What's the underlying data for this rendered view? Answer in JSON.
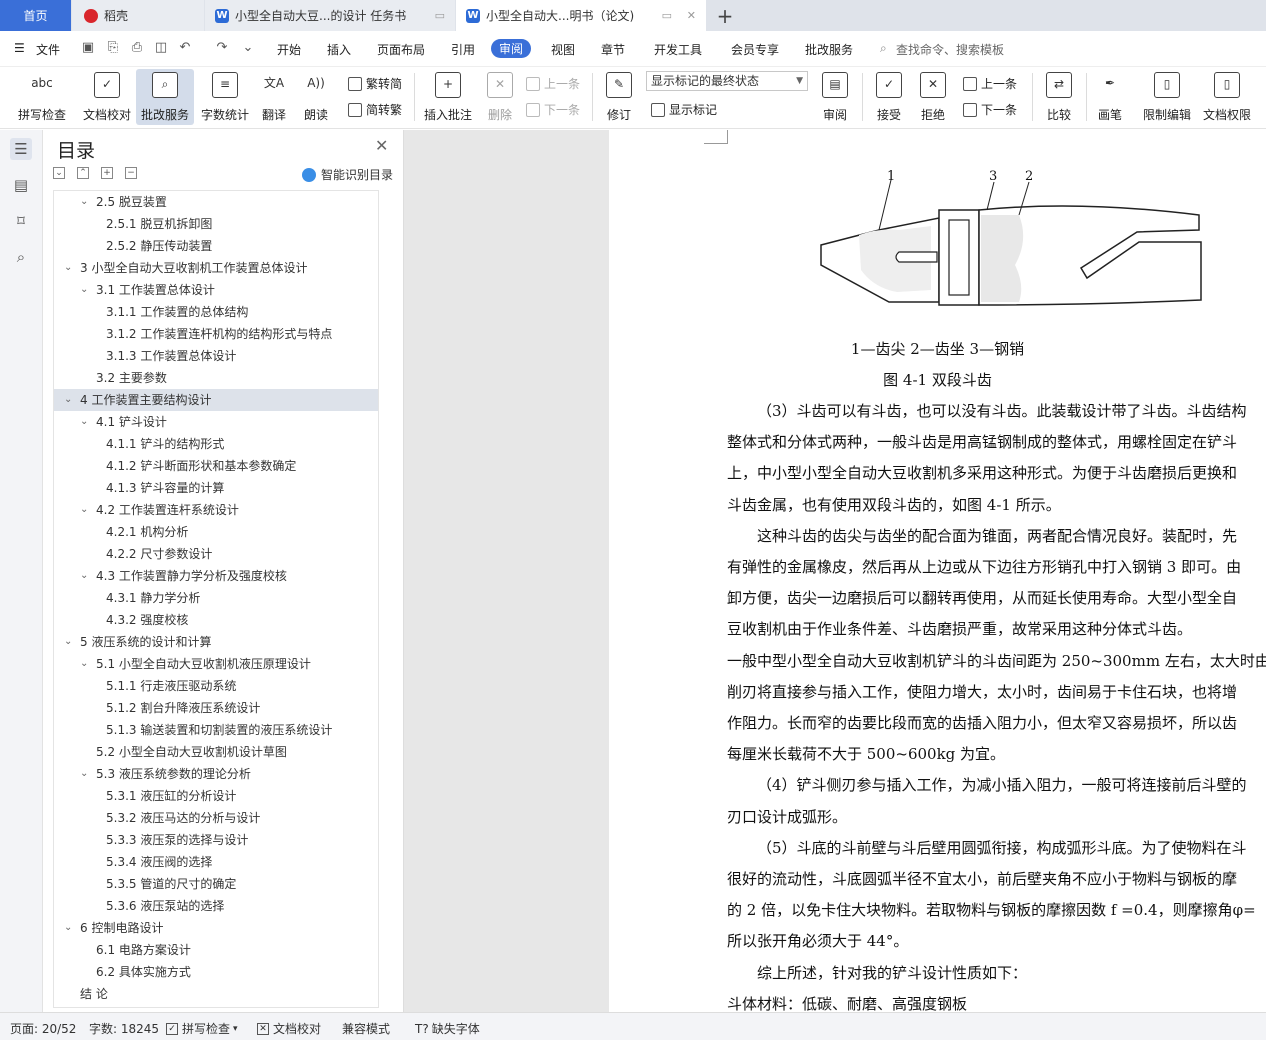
{
  "tabs": {
    "home": "首页",
    "wps": "稻壳",
    "task": "小型全自动大豆...的设计 任务书",
    "active": "小型全自动大...明书（论文)"
  },
  "menu": {
    "file": "文件",
    "items": [
      "开始",
      "插入",
      "页面布局",
      "引用",
      "审阅",
      "视图",
      "章节",
      "开发工具",
      "会员专享",
      "批改服务"
    ],
    "search_placeholder": "查找命令、搜索模板"
  },
  "ribbon": {
    "spellcheck": "拼写检查",
    "doc_check": "文档校对",
    "review_service": "批改服务",
    "word_count": "字数统计",
    "translate": "翻译",
    "read_aloud": "朗读",
    "trad_conv": "繁转简",
    "simp_conv": "简转繁",
    "insert_comment": "插入批注",
    "delete": "删除",
    "prev": "上一条",
    "next": "下一条",
    "revise": "修订",
    "markup_state": "显示标记的最终状态",
    "show_markup": "显示标记",
    "review": "审阅",
    "accept": "接受",
    "reject": "拒绝",
    "prev2": "上一条",
    "next2": "下一条",
    "compare": "比较",
    "pen": "画笔",
    "restrict_edit": "限制编辑",
    "doc_permission": "文档权限"
  },
  "toc": {
    "title": "目录",
    "smart": "智能识别目录",
    "items": [
      {
        "text": "2.5  脱豆装置",
        "level": 2,
        "toggle": "open"
      },
      {
        "text": "2.5.1  脱豆机拆卸图",
        "level": 3
      },
      {
        "text": "2.5.2  静压传动装置",
        "level": 3
      },
      {
        "text": "3  小型全自动大豆收割机工作装置总体设计",
        "level": 1,
        "toggle": "open"
      },
      {
        "text": "3.1  工作装置总体设计",
        "level": 2,
        "toggle": "open"
      },
      {
        "text": "3.1.1  工作装置的总体结构",
        "level": 3
      },
      {
        "text": "3.1.2  工作装置连杆机构的结构形式与特点",
        "level": 3
      },
      {
        "text": "3.1.3  工作装置总体设计",
        "level": 3
      },
      {
        "text": "3.2  主要参数",
        "level": 2
      },
      {
        "text": "4  工作装置主要结构设计",
        "level": 1,
        "toggle": "open",
        "selected": true
      },
      {
        "text": "4.1  铲斗设计",
        "level": 2,
        "toggle": "open"
      },
      {
        "text": "4.1.1  铲斗的结构形式",
        "level": 3
      },
      {
        "text": "4.1.2  铲斗断面形状和基本参数确定",
        "level": 3
      },
      {
        "text": "4.1.3  铲斗容量的计算",
        "level": 3
      },
      {
        "text": "4.2  工作装置连杆系统设计",
        "level": 2,
        "toggle": "open"
      },
      {
        "text": "4.2.1  机构分析",
        "level": 3
      },
      {
        "text": "4.2.2  尺寸参数设计",
        "level": 3
      },
      {
        "text": "4.3  工作装置静力学分析及强度校核",
        "level": 2,
        "toggle": "open"
      },
      {
        "text": "4.3.1  静力学分析",
        "level": 3
      },
      {
        "text": "4.3.2  强度校核",
        "level": 3
      },
      {
        "text": "5  液压系统的设计和计算",
        "level": 1,
        "toggle": "open"
      },
      {
        "text": "5.1  小型全自动大豆收割机液压原理设计",
        "level": 2,
        "toggle": "open"
      },
      {
        "text": "5.1.1  行走液压驱动系统",
        "level": 3
      },
      {
        "text": "5.1.2  割台升降液压系统设计",
        "level": 3
      },
      {
        "text": "5.1.3  输送装置和切割装置的液压系统设计",
        "level": 3
      },
      {
        "text": "5.2  小型全自动大豆收割机设计草图",
        "level": 2
      },
      {
        "text": "5.3  液压系统参数的理论分析",
        "level": 2,
        "toggle": "open"
      },
      {
        "text": "5.3.1  液压缸的分析设计",
        "level": 3
      },
      {
        "text": "5.3.2  液压马达的分析与设计",
        "level": 3
      },
      {
        "text": "5.3.3  液压泵的选择与设计",
        "level": 3
      },
      {
        "text": "5.3.4  液压阀的选择",
        "level": 3
      },
      {
        "text": "5.3.5  管道的尺寸的确定",
        "level": 3
      },
      {
        "text": "5.3.6  液压泵站的选择",
        "level": 3
      },
      {
        "text": "6  控制电路设计",
        "level": 1,
        "toggle": "open"
      },
      {
        "text": "6.1 电路方案设计",
        "level": 2
      },
      {
        "text": "6.2 具体实施方式",
        "level": 2
      },
      {
        "text": "结    论",
        "level": 1
      }
    ]
  },
  "doc": {
    "fig_labels": [
      "1",
      "3",
      "2"
    ],
    "legend": "1—齿尖    2—齿坐    3—钢销",
    "caption": "图 4-1    双段斗齿",
    "lines": [
      {
        "text": "（3）斗齿可以有斗齿，也可以没有斗齿。此装载设计带了斗齿。斗齿结构",
        "indent": true
      },
      {
        "text": "整体式和分体式两种，一般斗齿是用高锰钢制成的整体式，用螺栓固定在铲斗",
        "indent": false
      },
      {
        "text": "上，中小型小型全自动大豆收割机多采用这种形式。为便于斗齿磨损后更换和",
        "indent": false
      },
      {
        "text": "斗齿金属，也有使用双段斗齿的，如图 4-1 所示。",
        "indent": false
      },
      {
        "text": " 这种斗齿的齿尖与齿坐的配合面为锥面，两者配合情况良好。装配时，先",
        "indent": true
      },
      {
        "text": "有弹性的金属橡皮，然后再从上边或从下边往方形销孔中打入钢销 3 即可。由",
        "indent": false
      },
      {
        "text": "卸方便，齿尖一边磨损后可以翻转再使用，从而延长使用寿命。大型小型全自",
        "indent": false
      },
      {
        "text": "豆收割机由于作业条件差、斗齿磨损严重，故常采用这种分体式斗齿。",
        "indent": false
      },
      {
        "text": "一般中型小型全自动大豆收割机铲斗的斗齿间距为 250~300mm 左右，太大时由",
        "indent": false
      },
      {
        "text": "削刃将直接参与插入工作，使阻力增大，太小时，齿间易于卡住石块，也将增",
        "indent": false
      },
      {
        "text": "作阻力。长而窄的齿要比段而宽的齿插入阻力小，但太窄又容易损坏，所以齿",
        "indent": false
      },
      {
        "text": "每厘米长载荷不大于 500~600kg 为宜。",
        "indent": false
      },
      {
        "text": "（4）铲斗侧刃参与插入工作，为减小插入阻力，一般可将连接前后斗壁的",
        "indent": true
      },
      {
        "text": "刃口设计成弧形。",
        "indent": false
      },
      {
        "text": "（5）斗底的斗前壁与斗后壁用圆弧衔接，构成弧形斗底。为了使物料在斗",
        "indent": true
      },
      {
        "text": "很好的流动性，斗底圆弧半径不宜太小，前后壁夹角不应小于物料与钢板的摩",
        "indent": false
      },
      {
        "text": "的 2 倍，以免卡住大块物料。若取物料与钢板的摩擦因数 f =0.4，则摩擦角φ=",
        "indent": false
      },
      {
        "text": "所以张开角必须大于 44°。",
        "indent": false
      },
      {
        "text": "综上所述，针对我的铲斗设计性质如下：",
        "indent": true
      },
      {
        "text": "斗体材料：低碳、耐磨、高强度钢板",
        "indent": false
      }
    ]
  },
  "status": {
    "page": "页面: 20/52",
    "words": "字数: 18245",
    "spellcheck": "拼写检查",
    "doc_check": "文档校对",
    "compat": "兼容模式",
    "missing_font": "缺失字体"
  }
}
